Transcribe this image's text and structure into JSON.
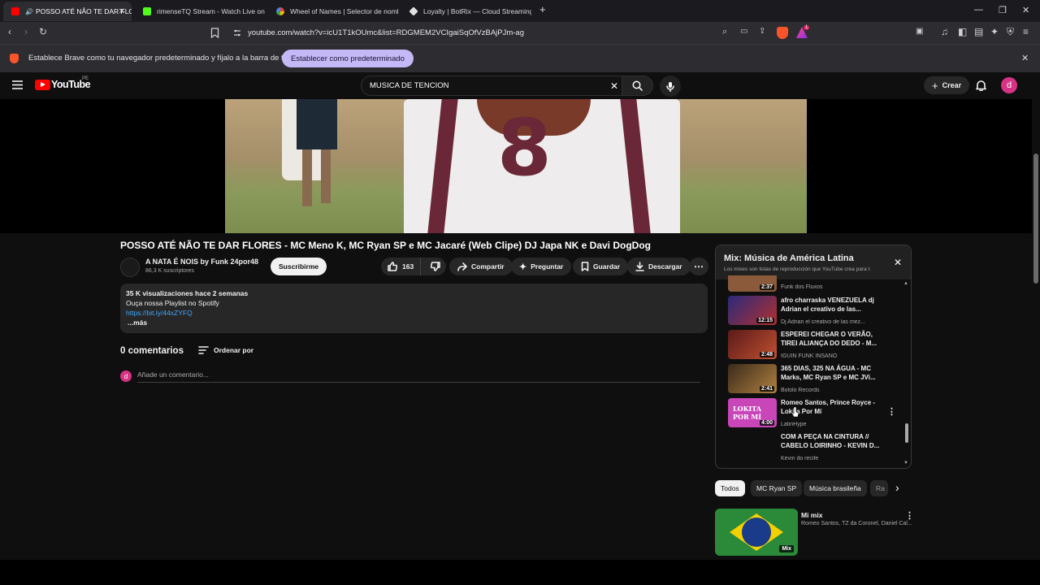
{
  "browser": {
    "tabs": [
      {
        "label": "POSSO ATÉ NÃO TE DAR FLO",
        "favicon_color": "#ff0000",
        "active": true
      },
      {
        "label": "rimenseTQ Stream - Watch Live on K",
        "favicon_color": "#53fc18",
        "active": false
      },
      {
        "label": "Wheel of Names | Selector de nombr",
        "favicon_color": "#4285f4",
        "active": false
      },
      {
        "label": "Loyalty | BotRix — Cloud Streaming B",
        "favicon_color": "#e0e0e0",
        "active": false
      }
    ],
    "url": "youtube.com/watch?v=icU1T1kOUmc&list=RDGMEM2VCIgaiSqOfVzBAjPJm-ag",
    "shield_badge": "1",
    "infobar": {
      "message": "Establece Brave como tu navegador predeterminado y fíjalo a la barra de tareas",
      "button": "Establecer como predeterminado"
    }
  },
  "youtube": {
    "logo_text": "YouTube",
    "region": "PE",
    "search_value": "MUSICA DE TENCION",
    "create_label": "Crear",
    "avatar_letter": "d"
  },
  "video": {
    "jersey_number": "8",
    "title": "POSSO ATÉ NÃO TE DAR FLORES - MC Meno K, MC Ryan SP e MC Jacaré (Web Clipe) DJ Japa NK e Davi DogDog",
    "channel": "A NATA É NOIS by Funk 24por48",
    "subscribers": "86,3 K suscriptores",
    "subscribe_label": "Suscribirme",
    "likes": "163",
    "share_label": "Compartir",
    "ask_label": "Preguntar",
    "save_label": "Guardar",
    "download_label": "Descargar",
    "description": {
      "stats": "35 K visualizaciones  hace 2 semanas",
      "line1": "Ouça nossa Playlist no Spotify",
      "link": "https://bit.ly/44xZYFQ",
      "more": "...más"
    }
  },
  "comments": {
    "count_label": "0 comentarios",
    "sort_label": "Ordenar por",
    "placeholder": "Añade un comentario..."
  },
  "playlist": {
    "title": "Mix: Música de América Latina",
    "subtitle": "Los mixes son listas de reproducción que YouTube crea para t",
    "items": [
      {
        "title": "",
        "channel": "Funk dos Fluxos",
        "duration": "2:37",
        "color": "#8a5a3a"
      },
      {
        "title": "afro charraska VENEZUELA dj Adrian el creativo de las...",
        "channel": "Dj Adrian el creativo de las mez...",
        "duration": "12:15",
        "color": "#3a3a9a"
      },
      {
        "title": "ESPEREI CHEGAR O VERÃO, TIREI ALIANÇA DO DEDO - M...",
        "channel": "IGUIN FUNK INSANO",
        "duration": "2:48",
        "color": "#7a2a2a"
      },
      {
        "title": "365 DIAS, 325 NA ÁGUA - MC Marks, MC Ryan SP e MC JVi...",
        "channel": "Bololo Records",
        "duration": "2:41",
        "color": "#6a4a2a"
      },
      {
        "title": "Romeo Santos, Prince Royce - Lokita Por Mí",
        "channel": "LatinHype",
        "duration": "4:00",
        "color": "#c846b8"
      },
      {
        "title": "COM A PEÇA NA CINTURA // CABELO LOIRINHO - KEVIN D...",
        "channel": "Kevin do recife",
        "duration": "",
        "color": "#0f0f0f"
      }
    ],
    "thumb_text": "LOKITA POR MÍ"
  },
  "chips": [
    "Todos",
    "MC Ryan SP",
    "Música brasileña",
    "Ra"
  ],
  "recommendation": {
    "title": "Mi mix",
    "subtitle": "Romeo Santos, TZ da Coronel, Daniel Cal...",
    "badge": "Mix"
  }
}
